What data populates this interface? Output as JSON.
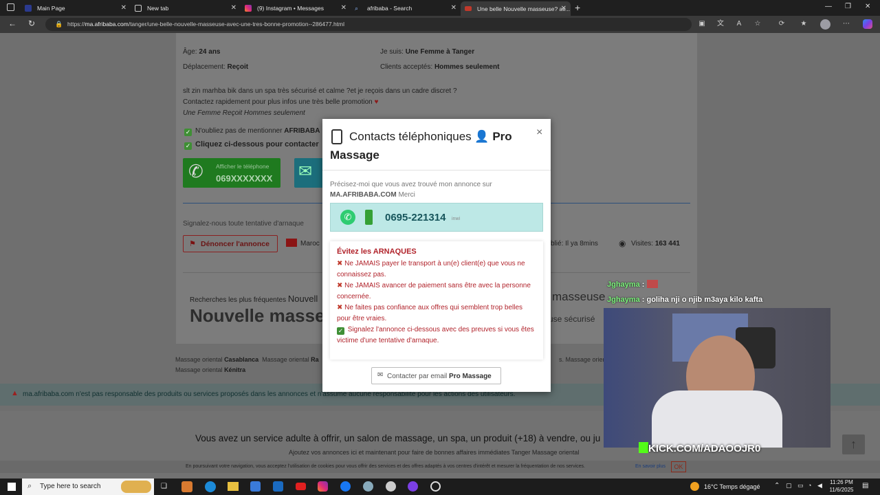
{
  "tabs": [
    {
      "label": "Main Page",
      "icon": "wiki-icon"
    },
    {
      "label": "New tab",
      "icon": "newtab-icon"
    },
    {
      "label": "(9) Instagram • Messages",
      "icon": "instagram-icon"
    },
    {
      "label": "afribaba - Search",
      "icon": "search-icon"
    },
    {
      "label": "Une belle Nouvelle masseuse? av...",
      "icon": "site-icon"
    }
  ],
  "address": {
    "prefix": "https://",
    "host": "ma.afribaba.com",
    "path": "/tanger/une-belle-nouvelle-masseuse-avec-une-tres-bonne-promotion--286477.html"
  },
  "listing": {
    "age_label": "Âge:",
    "age_value": "24 ans",
    "iam_label": "Je suis:",
    "iam_value": "Une Femme à Tanger",
    "move_label": "Déplacement:",
    "move_value": "Reçoit",
    "clients_label": "Clients acceptés:",
    "clients_value": "Hommes seulement",
    "desc1": "slt zin marhba bik dans un spa très sécurisé et calme ?et je reçois dans un cadre discret ?",
    "desc2": "Contactez rapidement pour plus infos une très belle promotion",
    "desc3": "Une Femme Reçoit Hommes seulement",
    "note1_pre": "N'oubliez pas de mentionner",
    "note1_brand": "AFRIBABA",
    "note2": "Cliquez ci-dessous pour contacter",
    "phone_btn_label": "Afficher le téléphone",
    "phone_btn_number": "069XXXXXXX",
    "report_prompt": "Signalez-nous toute tentative d'arnaque",
    "report_btn": "Dénoncer l'annonce",
    "country": "Maroc",
    "published": "blié: Il ya 8mins",
    "visits_label": "Visites:",
    "visits_value": "163 441",
    "searches_label": "Recherches les plus fréquentes",
    "searches_tail": "Nouvell",
    "big_left": "Nouvelle masseu",
    "big_right1": "masseuse",
    "big_right2": "use sécurisé"
  },
  "footer": {
    "links1": [
      "Massage oriental",
      "Casablanca",
      "Massage oriental",
      "Ra"
    ],
    "links1_tail": "s. Massage oriental",
    "links2": [
      "Massage oriental",
      "Kénitra"
    ],
    "disclaimer": "ma.afribaba.com n'est pas responsable des produits ou services proposés dans les annonces et n'assume aucune responsabilité pour les actions des utilisateurs.",
    "promo_title": "Vous avez un service adulte à offrir, un salon de massage, un spa, un produit (+18) à vendre, ou ju",
    "promo_sub": "Ajoutez vos annonces ici et maintenant pour faire de bonnes affaires immédiates Tanger Massage oriental",
    "cookie": "En poursuivant votre navigation, vous acceptez l'utilisation de cookies pour vous offrir des services et des offres adaptés à vos centres d'intérêt et mesurer la fréquentation de nos services.",
    "cookie_link": "En savoir plus",
    "cookie_ok": "OK"
  },
  "modal": {
    "title_a": "Contacts téléphoniques",
    "title_b": "Pro",
    "title_c": "Massage",
    "close": "×",
    "intro": "Précisez-moi que vous avez trouvé mon annonce sur",
    "intro_site": "MA.AFRIBABA.COM",
    "intro_end": "Merci",
    "phone": "0695-221314",
    "operator": "inwi",
    "warn_title": "Évitez les ARNAQUES",
    "warnings": [
      "Ne JAMAIS payer le transport à un(e) client(e) que vous ne connaissez pas.",
      "Ne JAMAIS avancer de paiement sans être avec la personne concernée.",
      "Ne faites pas confiance aux offres qui semblent trop belles pour être vraies."
    ],
    "warn_ok": "Signalez l'annonce ci-dessous avec des preuves si vous êtes victime d'une tentative d'arnaque.",
    "email_btn_pre": "Contacter par email",
    "email_btn_name": "Pro Massage"
  },
  "chat": [
    {
      "user": "Jghayma",
      "msg": ":"
    },
    {
      "user": "Jghayma",
      "msg": ": goliha nji o njib m3aya kilo kafta"
    }
  ],
  "stream_tag": "KICK.COM/ADAOOJR0",
  "taskbar": {
    "search_placeholder": "Type here to search",
    "weather": "16°C  Temps dégagé",
    "time": "11:26 PM",
    "date": "11/6/2025"
  },
  "colors": {
    "accent_green": "#2e8b2e",
    "phone_box": "#bde8e6",
    "warn_red": "#b1232b",
    "kick_green": "#53fc18"
  }
}
